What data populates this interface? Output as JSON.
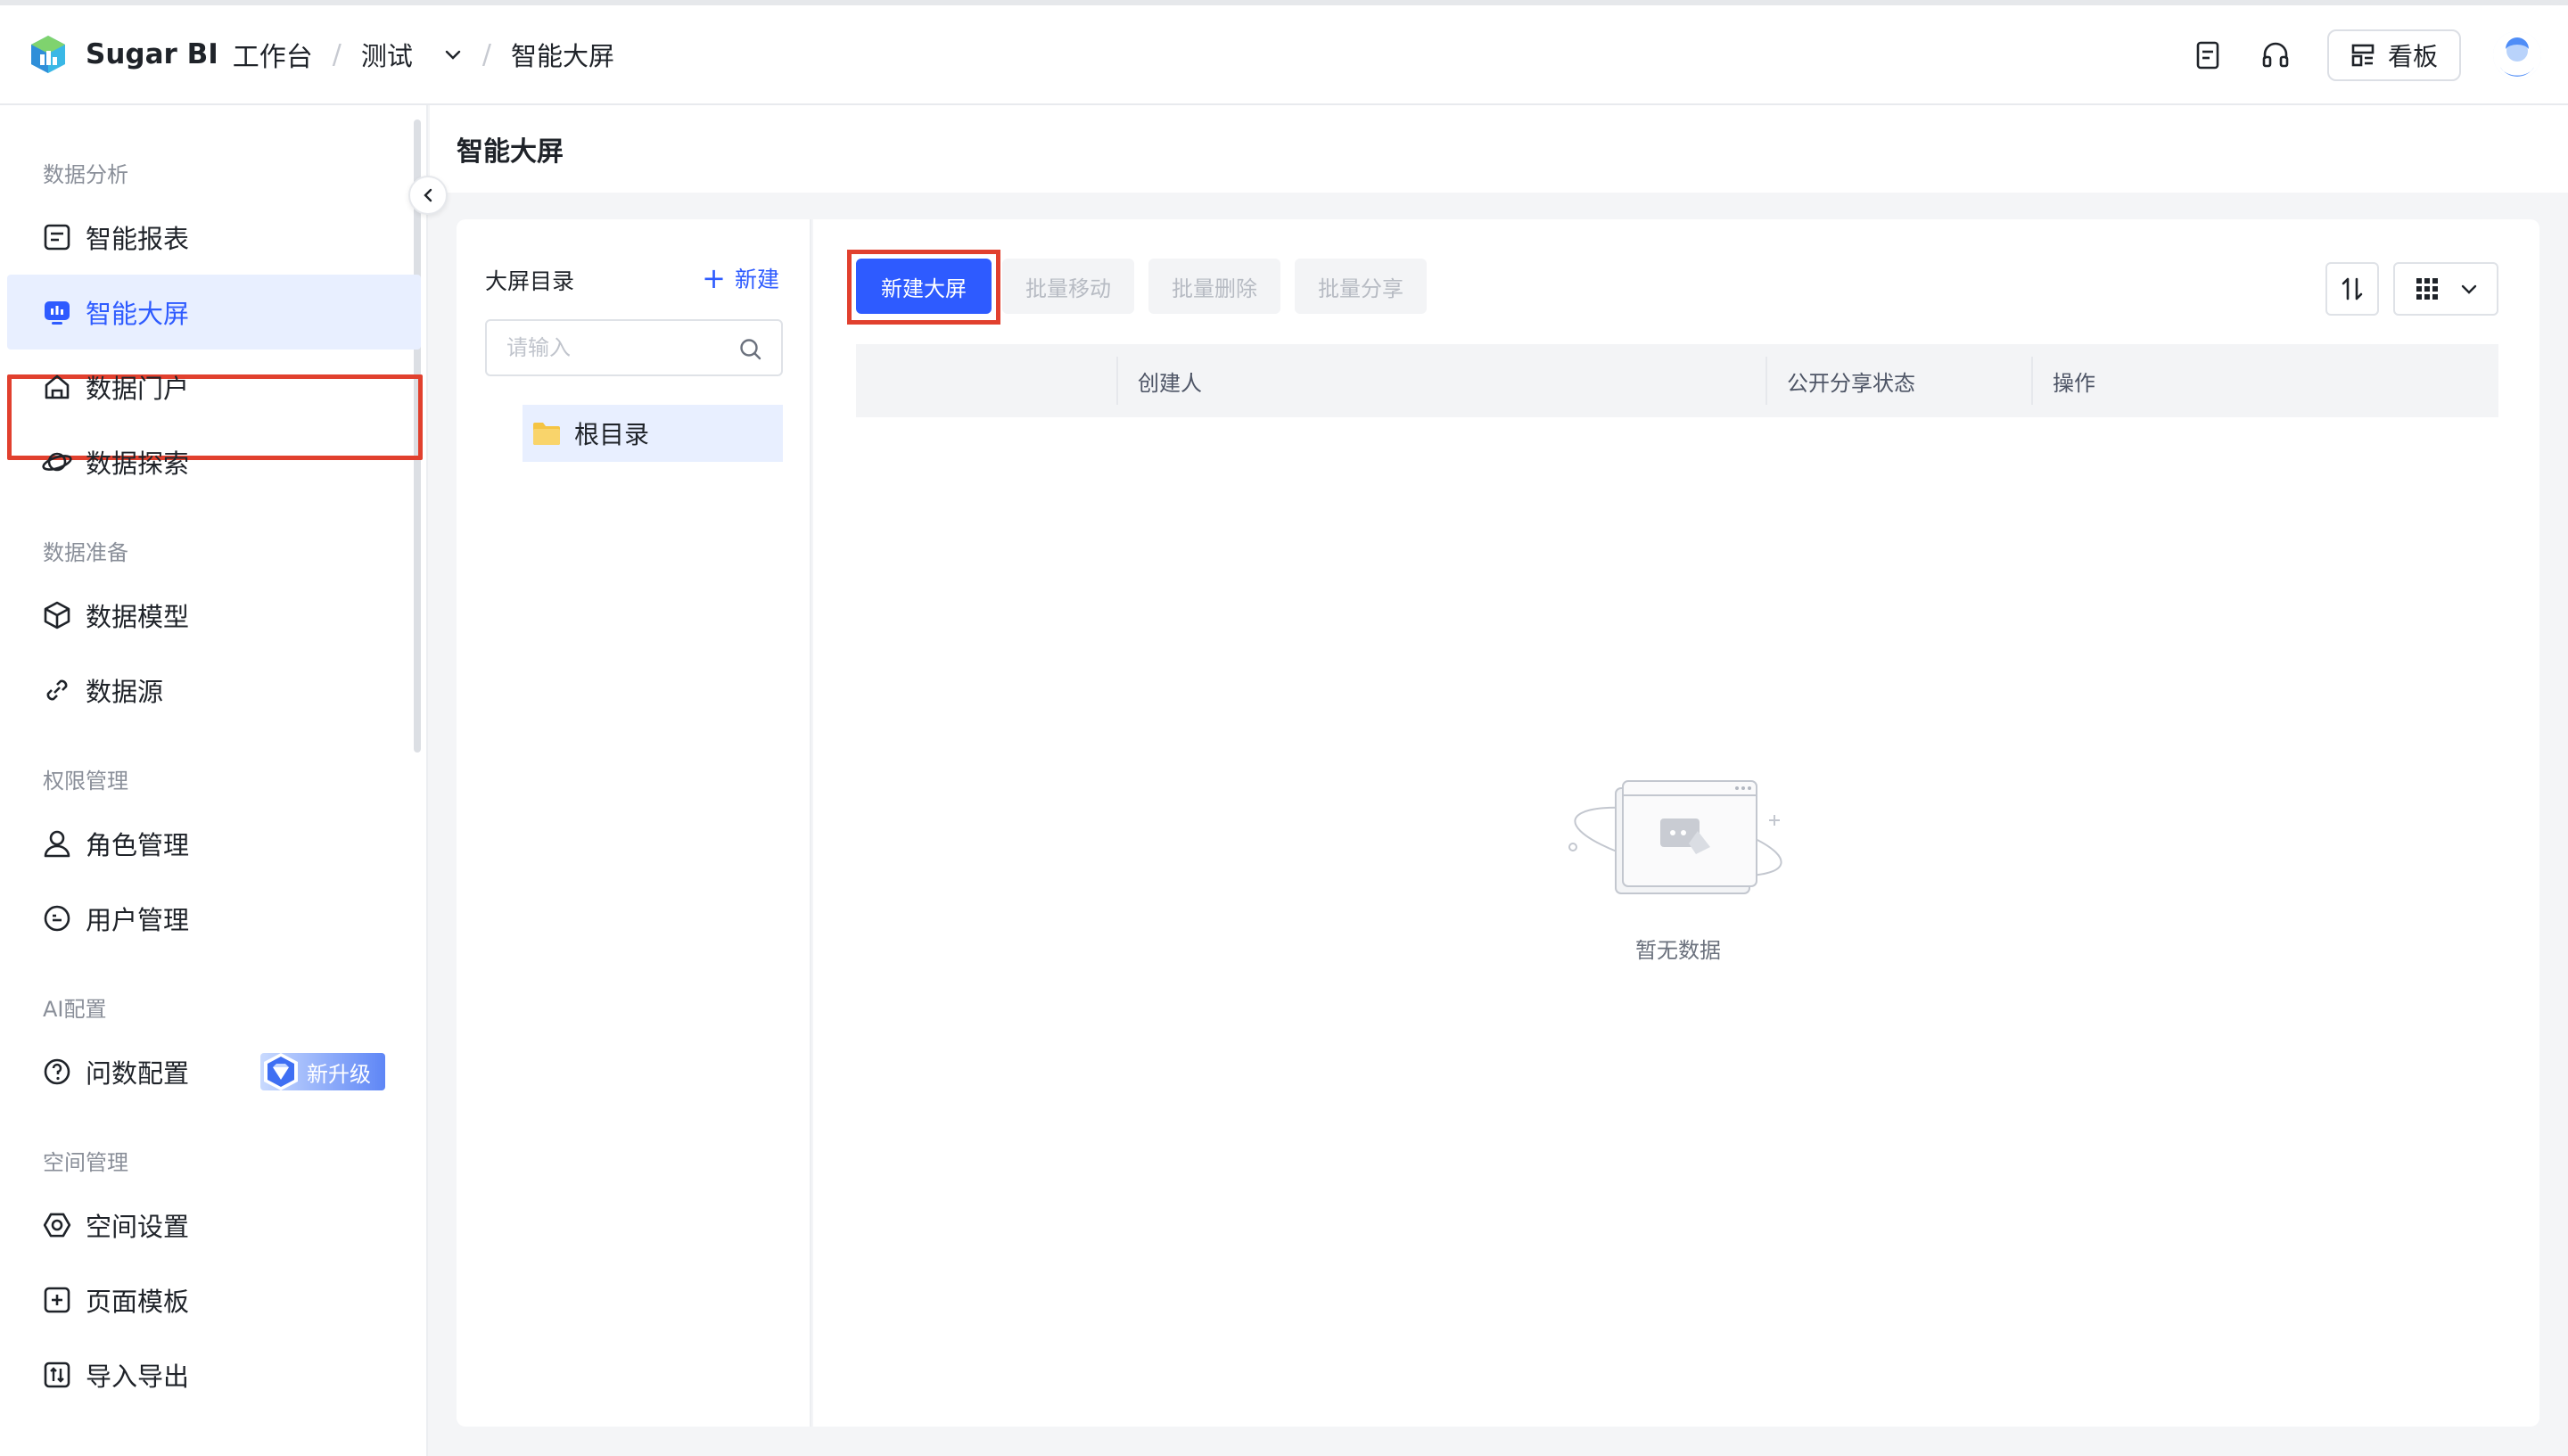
{
  "topbar": {
    "brand_name": "Sugar BI",
    "brand_sub": "工作台",
    "workspace": "测试",
    "current_page": "智能大屏",
    "kanban_label": "看板"
  },
  "sidebar": {
    "groups": {
      "analysis": "数据分析",
      "prep": "数据准备",
      "permission": "权限管理",
      "ai": "AI配置",
      "space": "空间管理"
    },
    "items": {
      "report": "智能报表",
      "screen": "智能大屏",
      "portal": "数据门户",
      "explore": "数据探索",
      "model": "数据模型",
      "source": "数据源",
      "role": "角色管理",
      "user": "用户管理",
      "ask": "问数配置",
      "space_settings": "空间设置",
      "template": "页面模板",
      "import_export": "导入导出"
    },
    "upgrade_badge": "新升级",
    "active_item": "智能大屏"
  },
  "main": {
    "title": "智能大屏"
  },
  "directory": {
    "title": "大屏目录",
    "new_label": "新建",
    "search_placeholder": "请输入",
    "root_label": "根目录"
  },
  "toolbar": {
    "new_screen": "新建大屏",
    "batch_move": "批量移动",
    "batch_delete": "批量删除",
    "batch_share": "批量分享"
  },
  "table": {
    "columns": [
      "",
      "创建人",
      "公开分享状态",
      "操作"
    ]
  },
  "empty_state": {
    "text": "暂无数据"
  },
  "colors": {
    "primary": "#2e5bff",
    "highlight_outline": "#e1402e",
    "active_bg": "#e8efff"
  },
  "icons": {
    "logo": "sugar-bi-logo",
    "doc": "document-icon",
    "headset": "headset-icon",
    "kanban": "kanban-icon",
    "search": "search-icon",
    "folder": "folder-icon",
    "sort": "sort-icon",
    "grid": "grid-view-icon"
  }
}
